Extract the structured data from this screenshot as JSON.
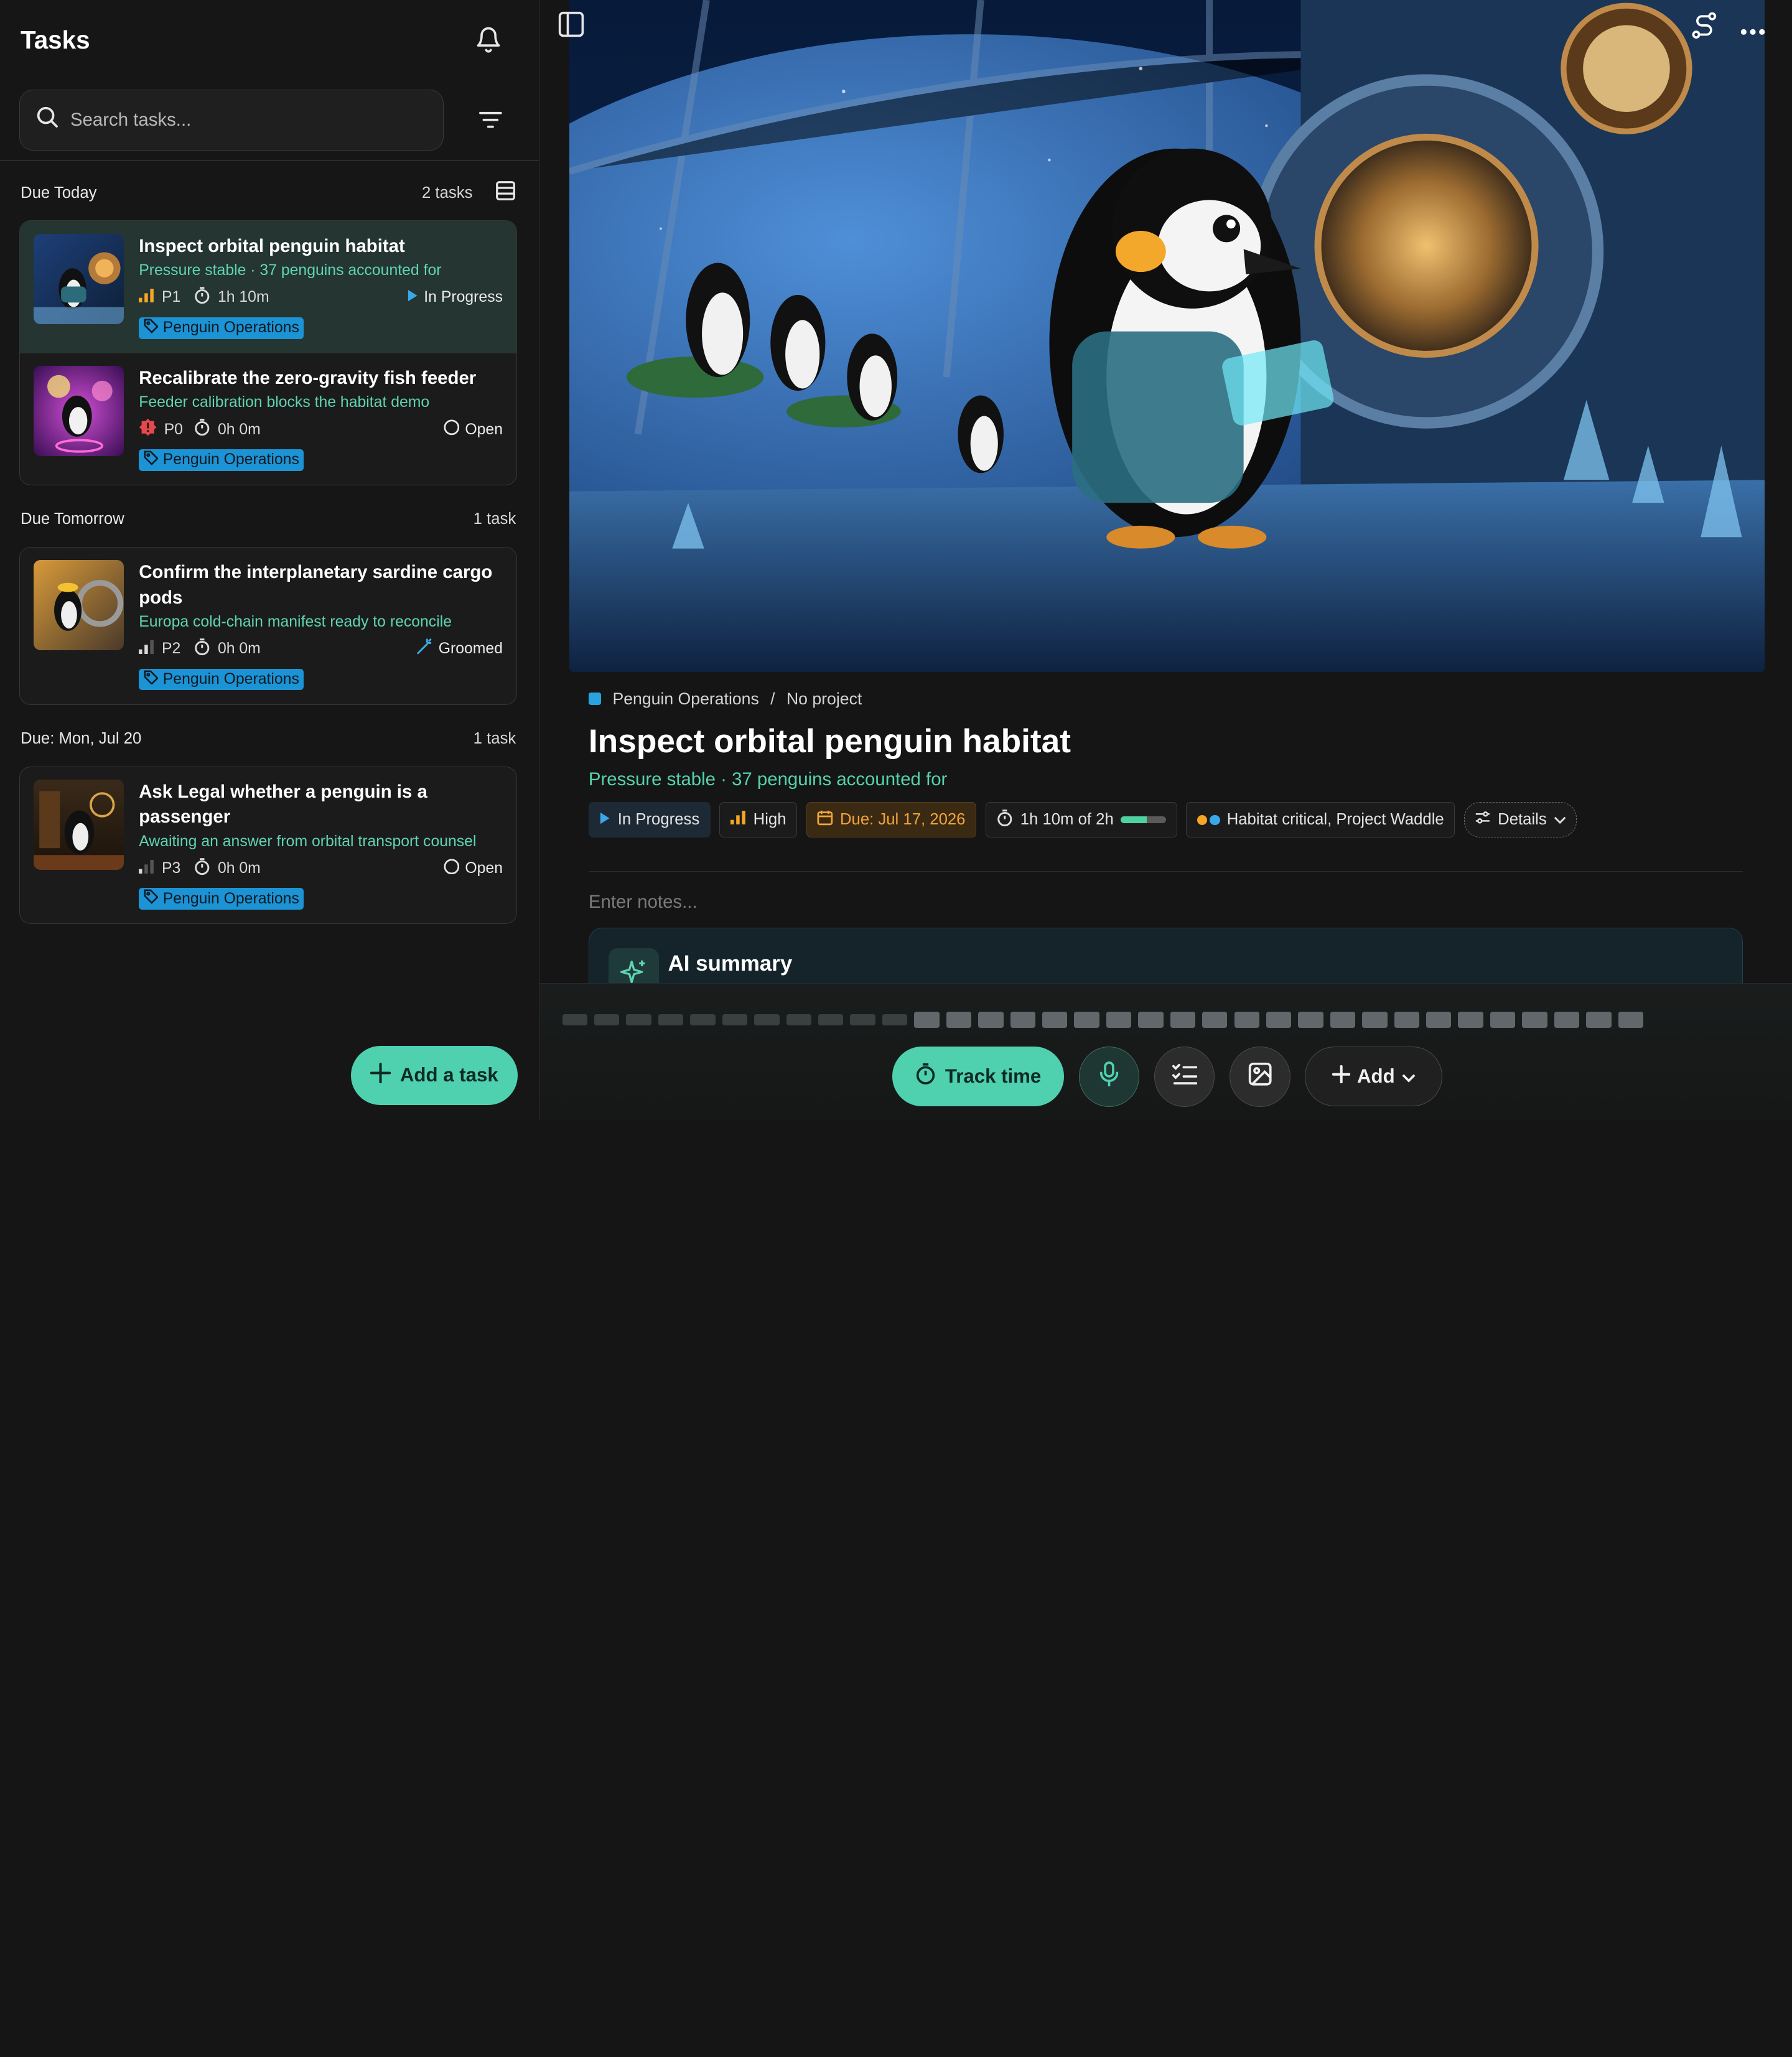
{
  "sidebar": {
    "title": "Tasks",
    "search_placeholder": "Search tasks...",
    "add_task_label": "Add a task",
    "groups": [
      {
        "heading": "Due Today",
        "count": "2 tasks",
        "tasks": [
          {
            "title": "Inspect orbital penguin habitat",
            "subtitle": "Pressure stable · 37 penguins accounted for",
            "priority": "P1",
            "time": "1h 10m",
            "status": "In Progress",
            "tag": "Penguin Operations"
          },
          {
            "title": "Recalibrate the zero-gravity fish feeder",
            "subtitle": "Feeder calibration blocks the habitat demo",
            "priority": "P0",
            "time": "0h 0m",
            "status": "Open",
            "tag": "Penguin Operations"
          }
        ]
      },
      {
        "heading": "Due Tomorrow",
        "count": "1 task",
        "tasks": [
          {
            "title": "Confirm the interplanetary sardine cargo pods",
            "subtitle": "Europa cold-chain manifest ready to reconcile",
            "priority": "P2",
            "time": "0h 0m",
            "status": "Groomed",
            "tag": "Penguin Operations"
          }
        ]
      },
      {
        "heading": "Due: Mon, Jul 20",
        "count": "1 task",
        "tasks": [
          {
            "title": "Ask Legal whether a penguin is a passenger",
            "subtitle": "Awaiting an answer from orbital transport counsel",
            "priority": "P3",
            "time": "0h 0m",
            "status": "Open",
            "tag": "Penguin Operations"
          }
        ]
      }
    ]
  },
  "detail": {
    "breadcrumb_team": "Penguin Operations",
    "breadcrumb_sep": "/",
    "breadcrumb_project": "No project",
    "title": "Inspect orbital penguin habitat",
    "subtitle": "Pressure stable · 37 penguins accounted for",
    "status": "In Progress",
    "priority": "High",
    "due": "Due: Jul 17, 2026",
    "time": "1h 10m of 2h",
    "time_progress": 0.58,
    "labels": "Habitat critical, Project Waddle",
    "details_label": "Details",
    "notes_placeholder": "Enter notes...",
    "ai_summary_title": "AI summary"
  },
  "toolbar": {
    "track_time": "Track time",
    "add": "Add"
  },
  "colors": {
    "accent": "#4fd1b0",
    "tag": "#1c93d4",
    "due": "#f2a43a"
  }
}
